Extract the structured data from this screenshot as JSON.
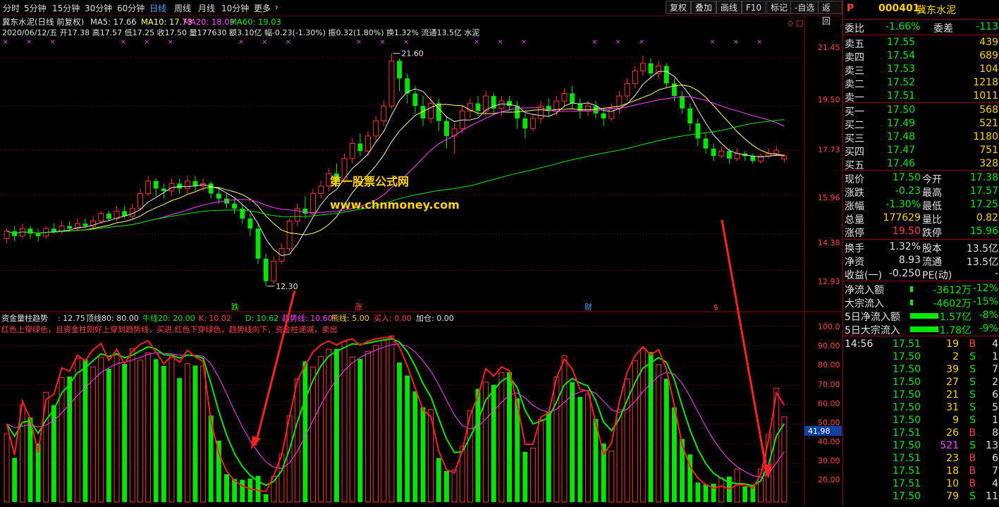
{
  "toolbar": {
    "tabs": [
      "分时",
      "5分钟",
      "15分钟",
      "30分钟",
      "60分钟",
      "日线",
      "周线",
      "月线",
      "10分钟",
      "更多"
    ],
    "active_tab": "日线",
    "buttons": [
      "复权",
      "叠加",
      "画线",
      "F10",
      "标记",
      "-自选",
      "返回"
    ]
  },
  "header": {
    "title": "冀东水泥(日线 前复权)",
    "ma5": "MA5: 17.66",
    "ma10": "MA10: 17.73",
    "ma20": "MA20: 18.09",
    "ma60": "MA60: 19.03",
    "info": "2020/06/12/五 开17.38 高17.57 低17.25 收17.50 量177630 额3.10亿 幅-0.23(-1.30%) 振0.32(1.80%) 换1.32% 流通13.5亿 水泥"
  },
  "price_axis": [
    "21.45",
    "19.50",
    "17.73",
    "15.96",
    "14.38",
    "12.93"
  ],
  "price_labels": {
    "high": "21.60",
    "low": "12.30"
  },
  "event_markers": [
    "跌",
    "涨",
    "财",
    "$"
  ],
  "watermark": {
    "line1": "第一股票公式网",
    "line2": "www.chnmoney.com"
  },
  "indicator": {
    "name": "资金量柱趋势",
    "value": ": 12.75",
    "params": [
      {
        "label": "顶线80: 80.00",
        "color": "#e0e0e0"
      },
      {
        "label": "牛线20: 20.00",
        "color": "#00e600"
      },
      {
        "label": "K: 10.02",
        "color": "#ff4040"
      },
      {
        "label": "D: 10.62",
        "color": "#00e600"
      },
      {
        "label": "趋势线: 10.60",
        "color": "#ff40ff"
      },
      {
        "label": "熊线: 5.00",
        "color": "#ffd200"
      },
      {
        "label": "买入: 0.00",
        "color": "#ff4040"
      },
      {
        "label": "加仓: 0.00",
        "color": "#e0e0e0"
      }
    ],
    "note": "红色上穿绿色，且资金柱刚好上穿到趋势线，买进,红色下穿绿色，趋势线向下，资金柱递减，卖出",
    "axis": [
      "100.0",
      "90.00",
      "80.00",
      "70.00",
      "60.00",
      "50.00",
      "40.00",
      "30.00",
      "20.00"
    ],
    "current": "41.98"
  },
  "quote": {
    "code": "000401",
    "name": "冀东水泥",
    "tag": "P",
    "weibi": {
      "label": "委比",
      "value": "-1.66%",
      "label2": "委差",
      "value2": "-113"
    },
    "asks": [
      {
        "label": "卖五",
        "price": "17.55",
        "vol": "439"
      },
      {
        "label": "卖四",
        "price": "17.54",
        "vol": "689"
      },
      {
        "label": "卖三",
        "price": "17.53",
        "vol": "104"
      },
      {
        "label": "卖二",
        "price": "17.52",
        "vol": "1218"
      },
      {
        "label": "卖一",
        "price": "17.51",
        "vol": "1011"
      }
    ],
    "bids": [
      {
        "label": "买一",
        "price": "17.50",
        "vol": "568"
      },
      {
        "label": "买二",
        "price": "17.49",
        "vol": "521"
      },
      {
        "label": "买三",
        "price": "17.48",
        "vol": "1180"
      },
      {
        "label": "买四",
        "price": "17.47",
        "vol": "751"
      },
      {
        "label": "买五",
        "price": "17.46",
        "vol": "328"
      }
    ],
    "stats": [
      {
        "l1": "现价",
        "v1": "17.50",
        "c1": "g",
        "l2": "今开",
        "v2": "17.38",
        "c2": "g"
      },
      {
        "l1": "涨跌",
        "v1": "-0.23",
        "c1": "g",
        "l2": "最高",
        "v2": "17.57",
        "c2": "g"
      },
      {
        "l1": "涨幅",
        "v1": "-1.30%",
        "c1": "g",
        "l2": "最低",
        "v2": "17.25",
        "c2": "g"
      },
      {
        "l1": "总量",
        "v1": "177629",
        "c1": "y",
        "l2": "量比",
        "v2": "0.82",
        "c2": "y"
      },
      {
        "l1": "涨停",
        "v1": "19.50",
        "c1": "r",
        "l2": "跌停",
        "v2": "15.96",
        "c2": "g"
      }
    ],
    "stats2": [
      {
        "l1": "换手",
        "v1": "1.32%",
        "l2": "股本",
        "v2": "13.5亿"
      },
      {
        "l1": "净资",
        "v1": "8.93",
        "l2": "流通",
        "v2": "13.5亿"
      },
      {
        "l1": "收益(一)",
        "v1": "-0.250",
        "l2": "PE(动)",
        "v2": "-"
      }
    ],
    "flows": [
      {
        "label": "净流入额",
        "value": "-3612万",
        "pct": "-12%",
        "bar": 0.05
      },
      {
        "label": "大宗流入",
        "value": "-4602万",
        "pct": "-15%",
        "bar": 0.05
      },
      {
        "label": "5日净流入额",
        "value": "-1.57亿",
        "pct": "-8%",
        "bar": 1.0
      },
      {
        "label": "5日大宗流入",
        "value": "-1.78亿",
        "pct": "-9%",
        "bar": 1.0
      }
    ],
    "ticks": [
      {
        "time": "14:56",
        "price": "17.51",
        "vol": "19",
        "bs": "B",
        "n": "4"
      },
      {
        "time": "",
        "price": "17.50",
        "vol": "2",
        "bs": "S",
        "n": "1"
      },
      {
        "time": "",
        "price": "17.50",
        "vol": "39",
        "bs": "S",
        "n": "7"
      },
      {
        "time": "",
        "price": "17.50",
        "vol": "27",
        "bs": "S",
        "n": "2"
      },
      {
        "time": "",
        "price": "17.50",
        "vol": "21",
        "bs": "S",
        "n": "6"
      },
      {
        "time": "",
        "price": "17.50",
        "vol": "31",
        "bs": "S",
        "n": "5"
      },
      {
        "time": "",
        "price": "17.50",
        "vol": "9",
        "bs": "S",
        "n": "1"
      },
      {
        "time": "",
        "price": "17.51",
        "vol": "26",
        "bs": "B",
        "n": "8"
      },
      {
        "time": "",
        "price": "17.50",
        "vol": "521",
        "bs": "S",
        "n": "13"
      },
      {
        "time": "",
        "price": "17.51",
        "vol": "23",
        "bs": "B",
        "n": "6"
      },
      {
        "time": "",
        "price": "17.51",
        "vol": "18",
        "bs": "B",
        "n": "7"
      },
      {
        "time": "",
        "price": "17.51",
        "vol": "10",
        "bs": "B",
        "n": "4"
      },
      {
        "time": "",
        "price": "17.50",
        "vol": "79",
        "bs": "S",
        "n": "11"
      }
    ]
  },
  "chart_data": {
    "type": "candlestick",
    "price_range": [
      11.9,
      22.1
    ],
    "candles": [
      [
        14.2,
        14.5,
        14.6,
        14.0
      ],
      [
        14.5,
        14.3,
        14.7,
        14.1
      ],
      [
        14.3,
        14.6,
        14.8,
        14.2
      ],
      [
        14.6,
        14.4,
        14.7,
        14.2
      ],
      [
        14.4,
        14.3,
        14.6,
        14.1
      ],
      [
        14.3,
        14.6,
        14.7,
        14.2
      ],
      [
        14.6,
        14.5,
        14.8,
        14.4
      ],
      [
        14.5,
        14.7,
        14.9,
        14.4
      ],
      [
        14.7,
        14.6,
        14.9,
        14.5
      ],
      [
        14.6,
        14.8,
        15.0,
        14.5
      ],
      [
        14.8,
        14.7,
        15.0,
        14.6
      ],
      [
        14.7,
        14.9,
        15.1,
        14.6
      ],
      [
        14.9,
        15.2,
        15.3,
        14.8
      ],
      [
        15.2,
        15.0,
        15.3,
        14.9
      ],
      [
        15.0,
        15.3,
        15.5,
        14.9
      ],
      [
        15.3,
        15.1,
        15.5,
        15.0
      ],
      [
        15.1,
        15.4,
        15.6,
        15.0
      ],
      [
        15.4,
        16.0,
        16.2,
        15.3
      ],
      [
        16.0,
        16.5,
        16.7,
        15.9
      ],
      [
        16.5,
        16.2,
        16.6,
        15.9
      ],
      [
        16.2,
        16.1,
        16.4,
        15.8
      ],
      [
        16.1,
        16.4,
        16.6,
        15.9
      ],
      [
        16.4,
        16.2,
        16.6,
        16.0
      ],
      [
        16.2,
        16.5,
        16.7,
        16.0
      ],
      [
        16.5,
        16.3,
        16.7,
        16.1
      ],
      [
        16.3,
        16.4,
        16.6,
        16.1
      ],
      [
        16.4,
        16.0,
        16.5,
        15.8
      ],
      [
        16.0,
        15.8,
        16.2,
        15.6
      ],
      [
        15.8,
        15.6,
        16.0,
        15.4
      ],
      [
        15.6,
        15.4,
        15.8,
        15.2
      ],
      [
        15.4,
        15.0,
        15.6,
        14.8
      ],
      [
        15.0,
        14.6,
        15.2,
        14.3
      ],
      [
        14.6,
        13.4,
        14.8,
        13.2
      ],
      [
        13.4,
        12.5,
        13.6,
        12.3
      ],
      [
        12.5,
        13.3,
        13.5,
        12.4
      ],
      [
        13.3,
        13.8,
        14.0,
        13.2
      ],
      [
        13.8,
        14.9,
        15.0,
        13.7
      ],
      [
        14.9,
        15.4,
        15.6,
        14.7
      ],
      [
        15.4,
        15.2,
        15.9,
        15.0
      ],
      [
        15.2,
        16.0,
        16.2,
        15.1
      ],
      [
        16.0,
        16.3,
        16.5,
        15.8
      ],
      [
        16.3,
        16.8,
        17.0,
        16.1
      ],
      [
        16.8,
        16.5,
        17.2,
        16.3
      ],
      [
        16.5,
        17.4,
        17.6,
        16.4
      ],
      [
        17.4,
        18.0,
        18.2,
        17.2
      ],
      [
        18.0,
        17.7,
        18.4,
        17.5
      ],
      [
        17.7,
        18.3,
        18.5,
        17.5
      ],
      [
        18.3,
        18.9,
        19.1,
        18.1
      ],
      [
        18.9,
        19.5,
        19.7,
        18.7
      ],
      [
        19.5,
        21.3,
        21.6,
        19.4
      ],
      [
        21.3,
        20.6,
        21.4,
        20.1
      ],
      [
        20.6,
        20.0,
        20.8,
        19.6
      ],
      [
        20.0,
        19.5,
        20.3,
        19.2
      ],
      [
        19.5,
        19.0,
        19.9,
        18.7
      ],
      [
        19.0,
        19.6,
        19.9,
        18.8
      ],
      [
        19.6,
        18.9,
        19.8,
        18.5
      ],
      [
        18.9,
        18.3,
        19.1,
        17.8
      ],
      [
        18.3,
        18.6,
        18.8,
        17.6
      ],
      [
        18.6,
        19.3,
        19.5,
        18.4
      ],
      [
        19.3,
        19.6,
        19.8,
        19.0
      ],
      [
        19.6,
        19.3,
        19.9,
        19.1
      ],
      [
        19.3,
        19.9,
        20.1,
        19.1
      ],
      [
        19.9,
        19.4,
        20.0,
        19.2
      ],
      [
        19.4,
        19.7,
        19.9,
        19.1
      ],
      [
        19.7,
        19.5,
        19.9,
        19.3
      ],
      [
        19.5,
        19.0,
        19.7,
        18.6
      ],
      [
        19.0,
        18.6,
        19.2,
        18.2
      ],
      [
        18.6,
        19.0,
        19.2,
        18.5
      ],
      [
        19.0,
        19.5,
        19.7,
        18.8
      ],
      [
        19.5,
        19.3,
        19.8,
        19.1
      ],
      [
        19.3,
        19.7,
        19.9,
        19.1
      ],
      [
        19.7,
        20.0,
        20.2,
        19.5
      ],
      [
        20.0,
        19.6,
        20.3,
        19.4
      ],
      [
        19.6,
        19.3,
        19.8,
        19.0
      ],
      [
        19.3,
        19.5,
        19.7,
        19.1
      ],
      [
        19.5,
        19.2,
        19.7,
        19.0
      ],
      [
        19.2,
        19.0,
        19.4,
        18.7
      ],
      [
        19.0,
        19.4,
        19.6,
        18.9
      ],
      [
        19.4,
        19.9,
        20.1,
        19.2
      ],
      [
        19.9,
        20.4,
        20.6,
        19.7
      ],
      [
        20.4,
        20.9,
        21.1,
        20.2
      ],
      [
        20.9,
        21.2,
        21.5,
        20.7
      ],
      [
        21.2,
        20.8,
        21.4,
        20.6
      ],
      [
        20.8,
        21.1,
        21.3,
        20.6
      ],
      [
        21.1,
        20.4,
        21.2,
        20.2
      ],
      [
        20.4,
        19.9,
        20.6,
        19.7
      ],
      [
        19.9,
        19.4,
        20.1,
        19.2
      ],
      [
        19.4,
        18.8,
        19.6,
        18.5
      ],
      [
        18.8,
        18.2,
        19.0,
        17.9
      ],
      [
        18.2,
        17.8,
        18.4,
        17.6
      ],
      [
        17.8,
        17.5,
        18.0,
        17.3
      ],
      [
        17.5,
        17.7,
        17.9,
        17.4
      ],
      [
        17.7,
        17.4,
        17.8,
        17.2
      ],
      [
        17.4,
        17.6,
        17.8,
        17.3
      ],
      [
        17.6,
        17.5,
        17.7,
        17.3
      ],
      [
        17.5,
        17.3,
        17.6,
        17.2
      ],
      [
        17.3,
        17.5,
        17.6,
        17.2
      ],
      [
        17.5,
        17.6,
        17.8,
        17.4
      ],
      [
        17.6,
        17.73,
        17.9,
        17.5
      ],
      [
        17.38,
        17.5,
        17.57,
        17.25
      ]
    ]
  }
}
